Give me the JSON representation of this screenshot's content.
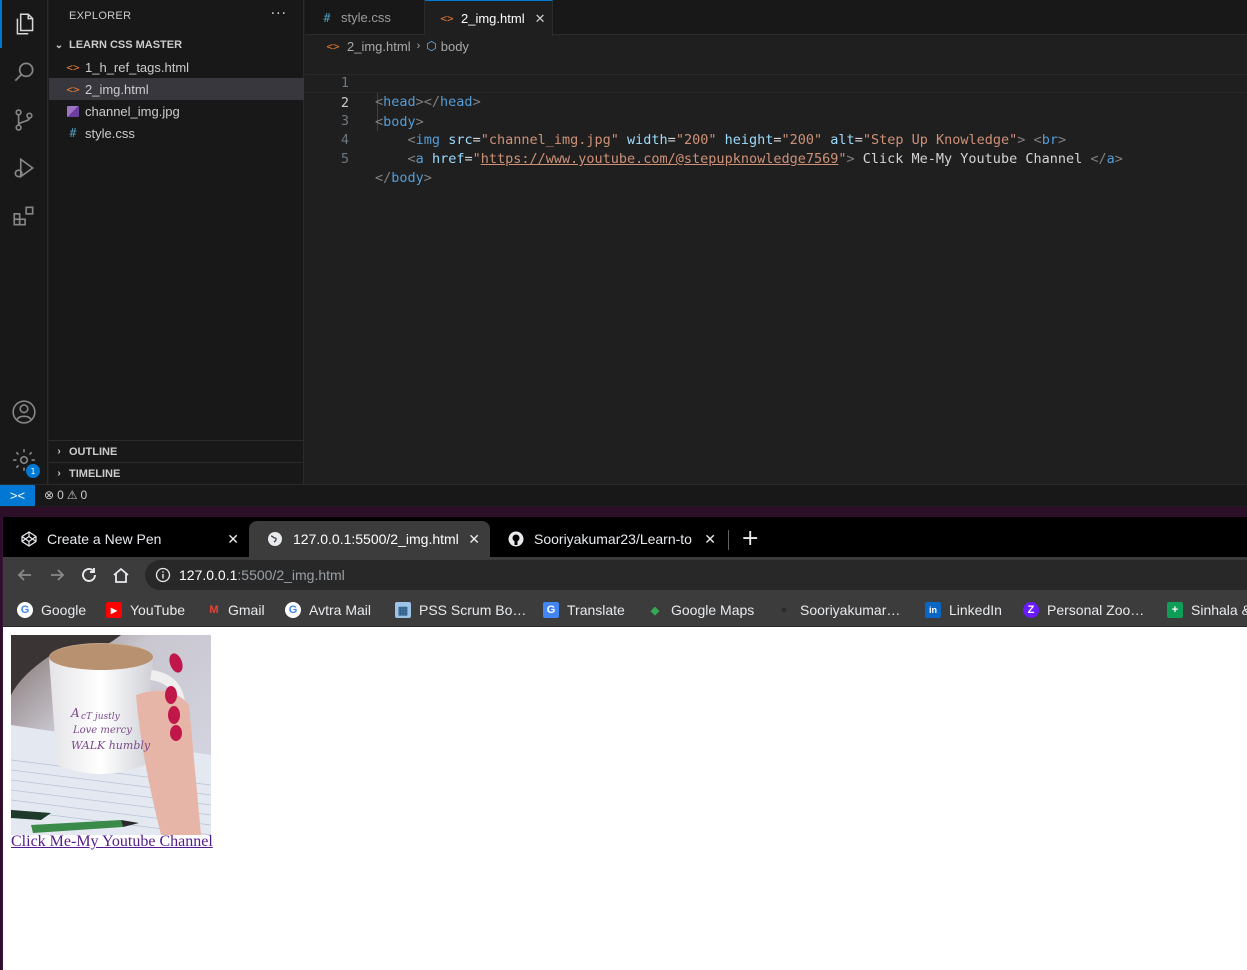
{
  "vscode": {
    "sidebar": {
      "header": "EXPLORER",
      "more": "···",
      "folder": "LEARN CSS MASTER",
      "files": [
        {
          "icon": "<>",
          "label": "1_h_ref_tags.html"
        },
        {
          "icon": "<>",
          "label": "2_img.html"
        },
        {
          "icon": "",
          "label": "channel_img.jpg"
        },
        {
          "icon": "#",
          "label": "style.css"
        }
      ],
      "outline": "OUTLINE",
      "timeline": "TIMELINE"
    },
    "activity": {
      "settings_badge": "1"
    },
    "tabs": [
      {
        "icon": "#",
        "label": "style.css"
      },
      {
        "icon": "<>",
        "label": "2_img.html",
        "close": "✕"
      }
    ],
    "breadcrumb": {
      "file_icon": "<>",
      "file": "2_img.html",
      "sep": "›",
      "symbol_icon": "⬡",
      "symbol": "body"
    },
    "line_numbers": [
      "1",
      "2",
      "3",
      "4",
      "5"
    ],
    "code": {
      "l1_open": "<",
      "l1_tag": "head",
      "l1_mid": "></",
      "l1_tag2": "head",
      "l1_close": ">",
      "l2_open": "<",
      "l2_tag": "body",
      "l2_close": ">",
      "l3_open": "<",
      "l3_tag": "img",
      "l3_a1": "src",
      "l3_v1": "\"channel_img.jpg\"",
      "l3_a2": "width",
      "l3_v2": "\"200\"",
      "l3_a3": "height",
      "l3_v3": "\"200\"",
      "l3_a4": "alt",
      "l3_v4": "\"Step Up Knowledge\"",
      "l3_close": ">",
      "l3_br_open": "<",
      "l3_br": "br",
      "l3_br_close": ">",
      "l4_open": "<",
      "l4_tag": "a",
      "l4_a1": "href",
      "l4_q1": "\"",
      "l4_url": "https://www.youtube.com/@stepupknowledge7569",
      "l4_q2": "\"",
      "l4_close": ">",
      "l4_text": " Click Me-My Youtube Channel ",
      "l4_end_open": "</",
      "l4_end_tag": "a",
      "l4_end_close": ">",
      "l5_open": "</",
      "l5_tag": "body",
      "l5_close": ">"
    },
    "status": {
      "remote": "><",
      "errors": "0",
      "warnings": "0"
    }
  },
  "browser": {
    "tabs": [
      {
        "title": "Create a New Pen",
        "close": "✕"
      },
      {
        "title": "127.0.0.1:5500/2_img.html",
        "close": "✕"
      },
      {
        "title": "Sooriyakumar23/Learn-to",
        "close": "✕"
      }
    ],
    "new_tab": "+",
    "url": {
      "host": "127.0.0.1",
      "path": ":5500/2_img.html"
    },
    "bookmarks": [
      {
        "label": "Google",
        "icon": "G",
        "color": "#4285f4"
      },
      {
        "label": "YouTube",
        "icon": "▶",
        "color": "#ff0000"
      },
      {
        "label": "Gmail",
        "icon": "M",
        "color": "#ea4335"
      },
      {
        "label": "Avtra Mail",
        "icon": "G",
        "color": "#4285f4"
      },
      {
        "label": "PSS Scrum Bo…",
        "icon": "▦",
        "color": "#9ec3e6"
      },
      {
        "label": "Translate",
        "icon": "G",
        "color": "#4285f4"
      },
      {
        "label": "Google Maps",
        "icon": "◆",
        "color": "#34a853"
      },
      {
        "label": "Sooriyakumar…",
        "icon": "●",
        "color": "#ffffff"
      },
      {
        "label": "LinkedIn",
        "icon": "in",
        "color": "#0a66c2"
      },
      {
        "label": "Personal Zoo…",
        "icon": "Z",
        "color": "#6a1bff"
      },
      {
        "label": "Sinhala &",
        "icon": "+",
        "color": "#0f9d58"
      }
    ],
    "page": {
      "image_alt": "Step Up Knowledge",
      "link_text": "Click Me-My Youtube Channel"
    }
  }
}
